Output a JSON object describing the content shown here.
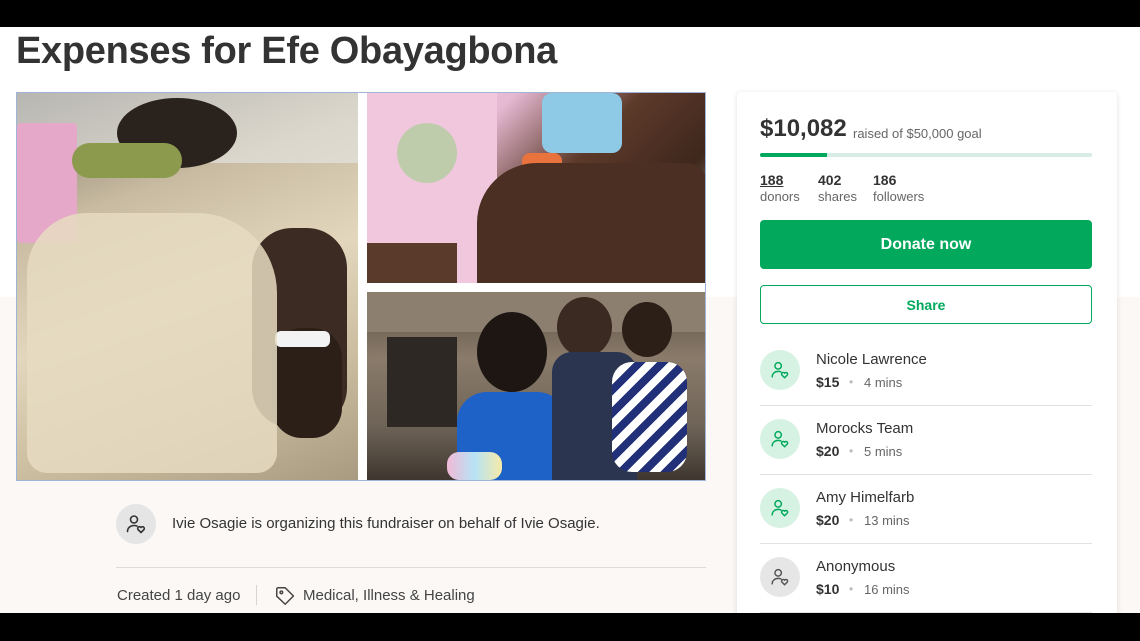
{
  "campaign": {
    "title": "Expenses for Efe Obayagbona"
  },
  "organizer": {
    "text": "Ivie Osagie is organizing this fundraiser on behalf of Ivie Osagie.",
    "avatar_icon": "user-heart-icon"
  },
  "meta": {
    "created": "Created 1 day ago",
    "category": "Medical, Illness & Healing",
    "category_icon": "tag-icon"
  },
  "donation": {
    "raised": "$10,082",
    "goal_text": "raised of $50,000 goal",
    "progress_fraction": 0.2016,
    "stats": [
      {
        "num": "188",
        "label": "donors"
      },
      {
        "num": "402",
        "label": "shares"
      },
      {
        "num": "186",
        "label": "followers"
      }
    ],
    "donate_label": "Donate now",
    "share_label": "Share"
  },
  "donors": [
    {
      "name": "Nicole Lawrence",
      "amount": "$15",
      "time": "4 mins",
      "avatar_color": "#d6f2e3"
    },
    {
      "name": "Morocks Team",
      "amount": "$20",
      "time": "5 mins",
      "avatar_color": "#d6f2e3"
    },
    {
      "name": "Amy Himelfarb",
      "amount": "$20",
      "time": "13 mins",
      "avatar_color": "#d6f2e3"
    },
    {
      "name": "Anonymous",
      "amount": "$10",
      "time": "16 mins",
      "avatar_color": "#e6e6e6"
    }
  ],
  "colors": {
    "accent": "#02a95c",
    "progress_track": "#d7ece4",
    "text": "#333333"
  }
}
